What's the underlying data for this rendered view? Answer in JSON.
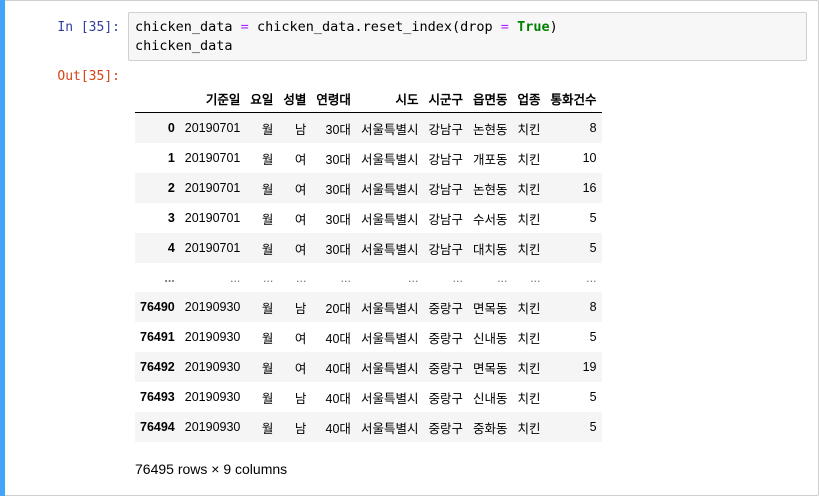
{
  "cell": {
    "in_prompt": "In [35]:",
    "out_prompt": "Out[35]:",
    "code_line1": {
      "a": "chicken_data ",
      "eq1": "=",
      "b": " chicken_data.reset_index(drop ",
      "eq2": "=",
      "c": " ",
      "kw": "True",
      "d": ")"
    },
    "code_line2": "chicken_data"
  },
  "table": {
    "columns": [
      "",
      "기준일",
      "요일",
      "성별",
      "연령대",
      "시도",
      "시군구",
      "읍면동",
      "업종",
      "통화건수"
    ],
    "rows": [
      [
        "0",
        "20190701",
        "월",
        "남",
        "30대",
        "서울특별시",
        "강남구",
        "논현동",
        "치킨",
        "8"
      ],
      [
        "1",
        "20190701",
        "월",
        "여",
        "30대",
        "서울특별시",
        "강남구",
        "개포동",
        "치킨",
        "10"
      ],
      [
        "2",
        "20190701",
        "월",
        "여",
        "30대",
        "서울특별시",
        "강남구",
        "논현동",
        "치킨",
        "16"
      ],
      [
        "3",
        "20190701",
        "월",
        "여",
        "30대",
        "서울특별시",
        "강남구",
        "수서동",
        "치킨",
        "5"
      ],
      [
        "4",
        "20190701",
        "월",
        "여",
        "30대",
        "서울특별시",
        "강남구",
        "대치동",
        "치킨",
        "5"
      ],
      [
        "...",
        "...",
        "...",
        "...",
        "...",
        "...",
        "...",
        "...",
        "...",
        "..."
      ],
      [
        "76490",
        "20190930",
        "월",
        "남",
        "20대",
        "서울특별시",
        "중랑구",
        "면목동",
        "치킨",
        "8"
      ],
      [
        "76491",
        "20190930",
        "월",
        "여",
        "40대",
        "서울특별시",
        "중랑구",
        "신내동",
        "치킨",
        "5"
      ],
      [
        "76492",
        "20190930",
        "월",
        "여",
        "40대",
        "서울특별시",
        "중랑구",
        "면목동",
        "치킨",
        "19"
      ],
      [
        "76493",
        "20190930",
        "월",
        "남",
        "40대",
        "서울특별시",
        "중랑구",
        "신내동",
        "치킨",
        "5"
      ],
      [
        "76494",
        "20190930",
        "월",
        "남",
        "40대",
        "서울특별시",
        "중랑구",
        "중화동",
        "치킨",
        "5"
      ]
    ]
  },
  "shape_note": "76495 rows × 9 columns"
}
